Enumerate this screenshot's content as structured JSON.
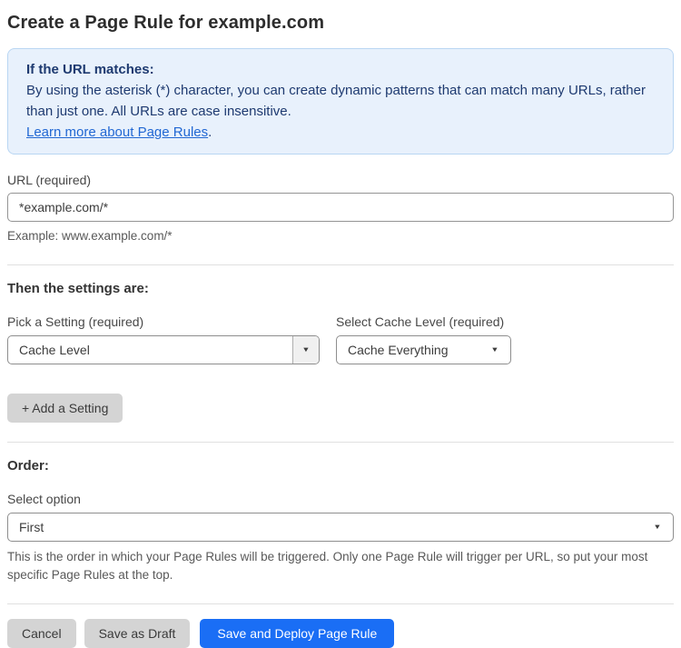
{
  "page": {
    "title": "Create a Page Rule for example.com"
  },
  "info_box": {
    "heading": "If the URL matches:",
    "body": "By using the asterisk (*) character, you can create dynamic patterns that can match many URLs, rather than just one. All URLs are case insensitive.",
    "link_label": "Learn more about Page Rules",
    "link_suffix": "."
  },
  "url_field": {
    "label": "URL (required)",
    "value": "*example.com/*",
    "helper": "Example: www.example.com/*"
  },
  "settings_section": {
    "heading": "Then the settings are:",
    "setting_picker": {
      "label": "Pick a Setting (required)",
      "value": "Cache Level"
    },
    "cache_level_picker": {
      "label": "Select Cache Level (required)",
      "value": "Cache Everything"
    },
    "add_setting_label": "+ Add a Setting"
  },
  "order_section": {
    "heading": "Order:",
    "label": "Select option",
    "value": "First",
    "helper": "This is the order in which your Page Rules will be triggered. Only one Page Rule will trigger per URL, so put your most specific Page Rules at the top."
  },
  "footer": {
    "cancel_label": "Cancel",
    "save_draft_label": "Save as Draft",
    "save_deploy_label": "Save and Deploy Page Rule"
  },
  "icons": {
    "dropdown_arrow": "▼"
  },
  "colors": {
    "info_bg": "#e8f1fc",
    "info_border": "#b9d6f3",
    "info_text": "#1e3a70",
    "link": "#2268d3",
    "primary_button": "#1a6ef5",
    "secondary_button": "#d4d4d4"
  }
}
